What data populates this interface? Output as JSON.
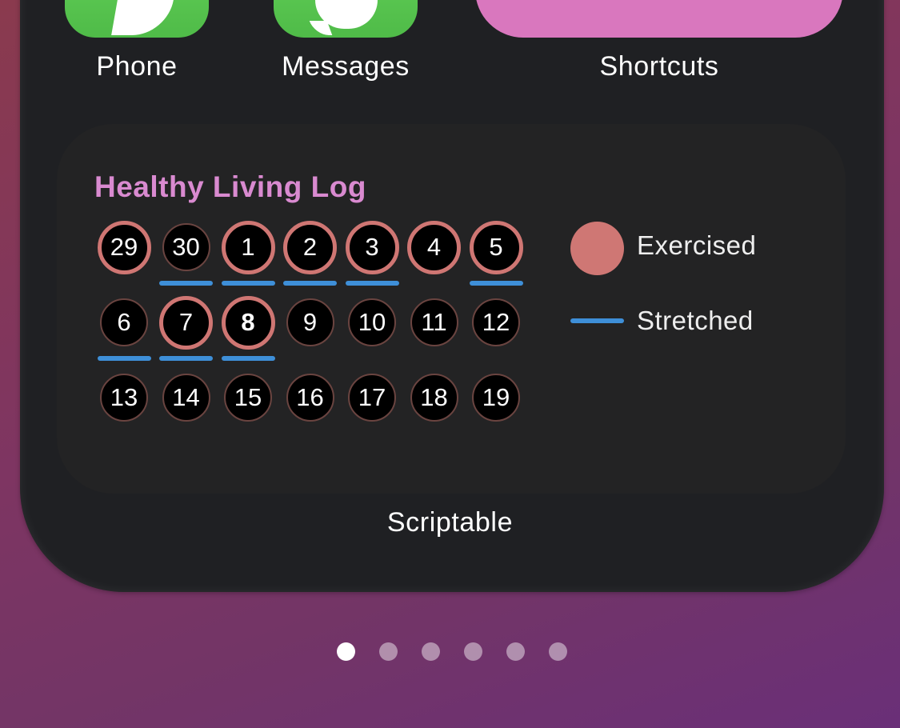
{
  "apps": [
    {
      "name": "Phone",
      "icon": "phone-icon",
      "color": "#57c44f"
    },
    {
      "name": "Messages",
      "icon": "messages-icon",
      "color": "#57c44f"
    },
    {
      "name": "Shortcuts",
      "icon": "shortcuts-icon",
      "color": "#d977be"
    }
  ],
  "widget": {
    "app_name": "Scriptable",
    "title": "Healthy Living Log",
    "title_color": "#d98ad0",
    "exercised_color": "#cf7673",
    "stretched_color": "#3e8fd8",
    "rows": [
      [
        {
          "day": "29",
          "exercised": true,
          "stretched": false,
          "today": false
        },
        {
          "day": "30",
          "exercised": false,
          "stretched": true,
          "today": false
        },
        {
          "day": "1",
          "exercised": true,
          "stretched": true,
          "today": false
        },
        {
          "day": "2",
          "exercised": true,
          "stretched": true,
          "today": false
        },
        {
          "day": "3",
          "exercised": true,
          "stretched": true,
          "today": false
        },
        {
          "day": "4",
          "exercised": true,
          "stretched": false,
          "today": false
        },
        {
          "day": "5",
          "exercised": true,
          "stretched": true,
          "today": false
        }
      ],
      [
        {
          "day": "6",
          "exercised": false,
          "stretched": true,
          "today": false
        },
        {
          "day": "7",
          "exercised": true,
          "stretched": true,
          "today": false
        },
        {
          "day": "8",
          "exercised": true,
          "stretched": true,
          "today": true
        },
        {
          "day": "9",
          "exercised": false,
          "stretched": false,
          "today": false
        },
        {
          "day": "10",
          "exercised": false,
          "stretched": false,
          "today": false
        },
        {
          "day": "11",
          "exercised": false,
          "stretched": false,
          "today": false
        },
        {
          "day": "12",
          "exercised": false,
          "stretched": false,
          "today": false
        }
      ],
      [
        {
          "day": "13",
          "exercised": false,
          "stretched": false,
          "today": false
        },
        {
          "day": "14",
          "exercised": false,
          "stretched": false,
          "today": false
        },
        {
          "day": "15",
          "exercised": false,
          "stretched": false,
          "today": false
        },
        {
          "day": "16",
          "exercised": false,
          "stretched": false,
          "today": false
        },
        {
          "day": "17",
          "exercised": false,
          "stretched": false,
          "today": false
        },
        {
          "day": "18",
          "exercised": false,
          "stretched": false,
          "today": false
        },
        {
          "day": "19",
          "exercised": false,
          "stretched": false,
          "today": false
        }
      ]
    ],
    "legend": {
      "exercised": "Exercised",
      "stretched": "Stretched"
    }
  },
  "page_indicator": {
    "total_pages": 6,
    "current_page": 1
  }
}
